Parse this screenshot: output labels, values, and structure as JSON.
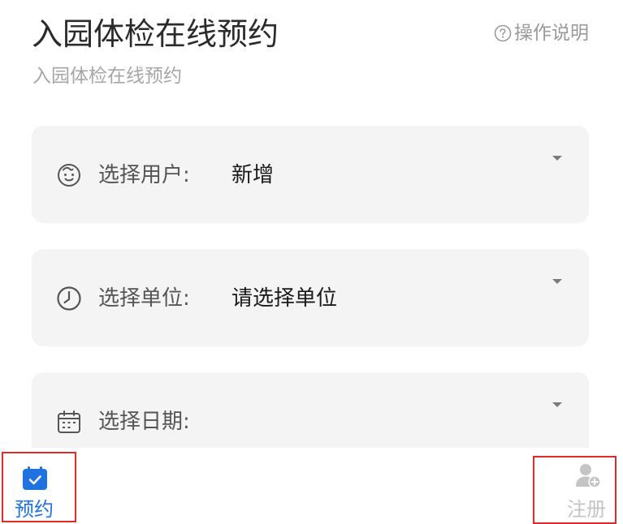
{
  "header": {
    "title": "入园体检在线预约",
    "subtitle": "入园体检在线预约",
    "help_label": "操作说明",
    "help_icon": "question-circle-icon"
  },
  "form": {
    "fields": [
      {
        "icon": "baby-face-icon",
        "label": "选择用户:",
        "value": "新增"
      },
      {
        "icon": "clock-icon",
        "label": "选择单位:",
        "value": "请选择单位"
      },
      {
        "icon": "calendar-icon",
        "label": "选择日期:",
        "value": ""
      }
    ]
  },
  "tabbar": {
    "items": [
      {
        "label": "预约",
        "icon": "calendar-check-icon",
        "active": true,
        "color": "#1f72e0"
      },
      {
        "label": "注册",
        "icon": "user-add-icon",
        "active": false,
        "color": "#c4c4c4"
      }
    ],
    "highlight_color": "#e02b2b"
  }
}
